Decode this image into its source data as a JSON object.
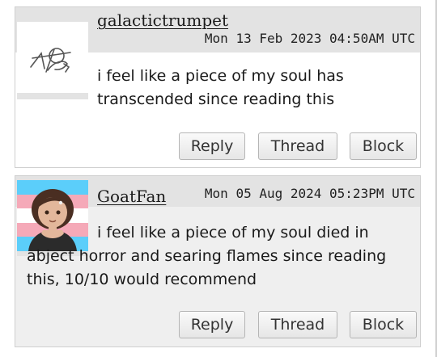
{
  "comments": [
    {
      "username": "galactictrumpet",
      "timestamp": "Mon 13 Feb 2023 04:50AM UTC",
      "text": "i feel like a piece of my soul has transcended since reading this",
      "avatar": "sketch-logo-icon",
      "actions": {
        "reply": "Reply",
        "thread": "Thread",
        "block": "Block"
      }
    },
    {
      "username": "GoatFan",
      "timestamp": "Mon 05 Aug 2024 05:23PM UTC",
      "text": "i feel like a piece of my soul died in abject horror and searing flames since reading this, 10/10 would recommend",
      "avatar": "character-portrait-trans-flag",
      "actions": {
        "reply": "Reply",
        "thread": "Thread",
        "block": "Block"
      }
    }
  ],
  "colors": {
    "header_bg": "#e3e3e3",
    "card_bg": "#efefef",
    "trans_blue": "#5bcefa",
    "trans_pink": "#f5a9b8"
  }
}
